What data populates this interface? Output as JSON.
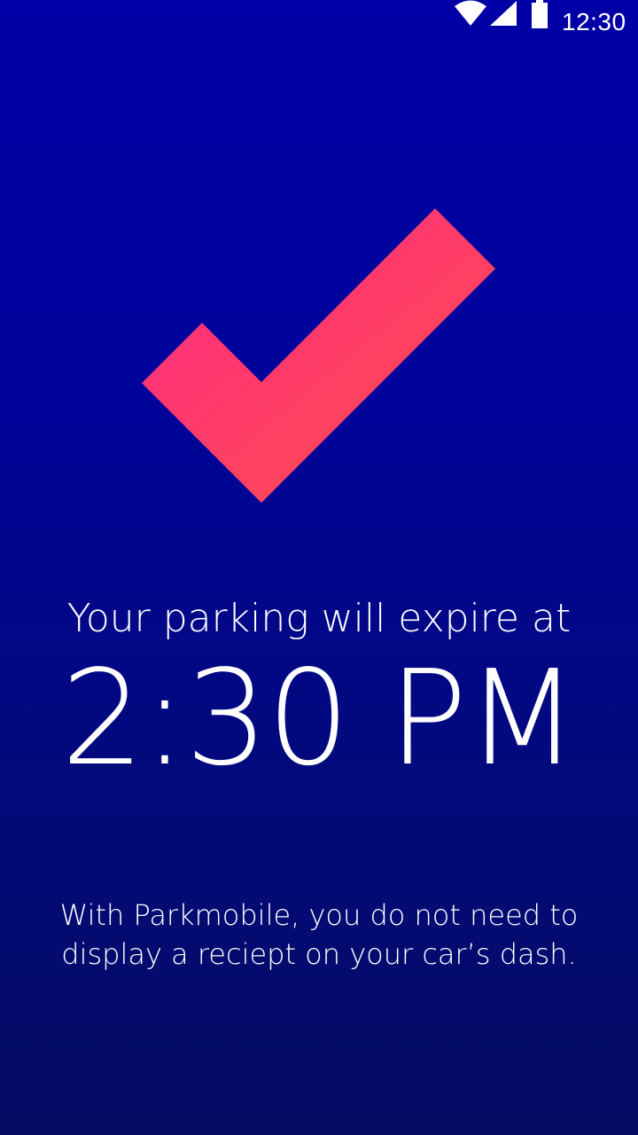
{
  "status_bar": {
    "time": "12:30",
    "icons": [
      "wifi-icon",
      "signal-icon",
      "battery-icon"
    ]
  },
  "confirmation": {
    "icon": "check-icon",
    "expire_label": "Your parking will expire at",
    "expire_time": "2:30 PM",
    "info": "With Parkmobile, you do not need to display a reciept on your car’s dash."
  },
  "colors": {
    "background_top": "#0000a6",
    "background_bottom": "#040c63",
    "check_start": "#ff2e7e",
    "check_end": "#ff4b4b",
    "text": "#ffffff"
  }
}
